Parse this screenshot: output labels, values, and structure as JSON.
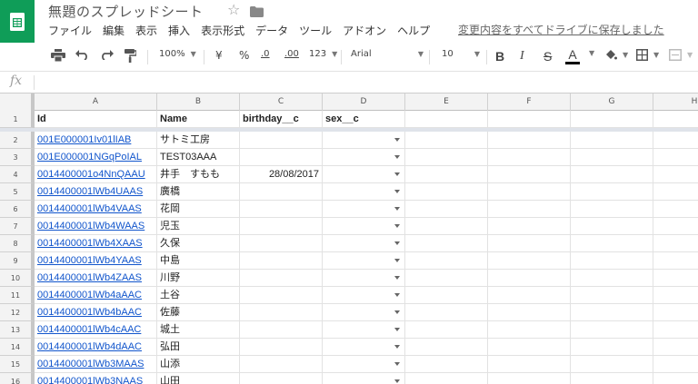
{
  "app": {
    "title": "無題のスプレッドシート",
    "save_status": "変更内容をすべてドライブに保存しました"
  },
  "menu": [
    "ファイル",
    "編集",
    "表示",
    "挿入",
    "表示形式",
    "データ",
    "ツール",
    "アドオン",
    "ヘルプ"
  ],
  "toolbar": {
    "zoom": "100%",
    "currency": "¥",
    "percent": "%",
    "decimal_decrease": ".0",
    "decimal_increase": ".00",
    "more_formats": "123",
    "font": "Arial",
    "font_size": "10",
    "bold": "B",
    "italic": "I",
    "strike": "S",
    "text_color_letter": "A",
    "accent_color": "#0f9d58",
    "text_color": "#000000"
  },
  "formula_bar": {
    "fx": "fx",
    "value": ""
  },
  "columns": [
    "A",
    "B",
    "C",
    "D",
    "E",
    "F",
    "G",
    "H"
  ],
  "header_row": {
    "row_num": "1",
    "cells": [
      "Id",
      "Name",
      "birthday__c",
      "sex__c"
    ]
  },
  "rows": [
    {
      "num": "2",
      "id": "001E000001Iv01lIAB",
      "name": "サトミ工房",
      "birthday": ""
    },
    {
      "num": "3",
      "id": "001E000001NGqPoIAL",
      "name": "TEST03AAA",
      "birthday": ""
    },
    {
      "num": "4",
      "id": "0014400001o4NnQAAU",
      "name": "井手　すもも",
      "birthday": "28/08/2017"
    },
    {
      "num": "5",
      "id": "0014400001lWb4UAAS",
      "name": "廣橋",
      "birthday": ""
    },
    {
      "num": "6",
      "id": "0014400001lWb4VAAS",
      "name": "花岡",
      "birthday": ""
    },
    {
      "num": "7",
      "id": "0014400001lWb4WAAS",
      "name": "児玉",
      "birthday": ""
    },
    {
      "num": "8",
      "id": "0014400001lWb4XAAS",
      "name": "久保",
      "birthday": ""
    },
    {
      "num": "9",
      "id": "0014400001lWb4YAAS",
      "name": "中島",
      "birthday": ""
    },
    {
      "num": "10",
      "id": "0014400001lWb4ZAAS",
      "name": "川野",
      "birthday": ""
    },
    {
      "num": "11",
      "id": "0014400001lWb4aAAC",
      "name": "土谷",
      "birthday": ""
    },
    {
      "num": "12",
      "id": "0014400001lWb4bAAC",
      "name": "佐藤",
      "birthday": ""
    },
    {
      "num": "13",
      "id": "0014400001lWb4cAAC",
      "name": "城土",
      "birthday": ""
    },
    {
      "num": "14",
      "id": "0014400001lWb4dAAC",
      "name": "弘田",
      "birthday": ""
    },
    {
      "num": "15",
      "id": "0014400001lWb3MAAS",
      "name": "山添",
      "birthday": ""
    },
    {
      "num": "16",
      "id": "0014400001lWb3NAAS",
      "name": "山田",
      "birthday": ""
    }
  ]
}
